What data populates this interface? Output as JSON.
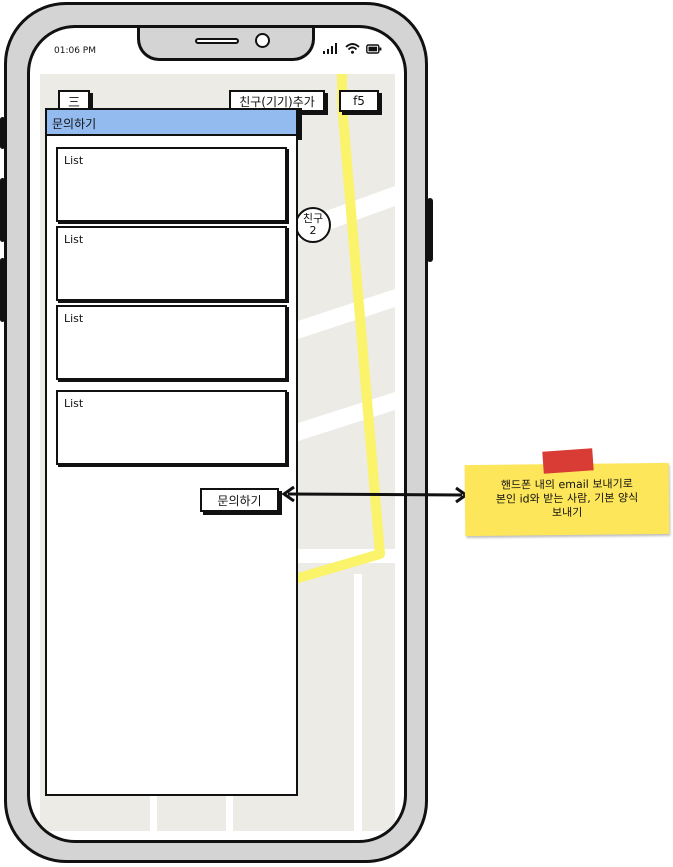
{
  "status_bar": {
    "time": "01:06 PM",
    "icons": [
      "signal-icon",
      "wifi-icon",
      "battery-icon"
    ]
  },
  "toolbar": {
    "menu_label": "三",
    "add_friend_label": "친구(기기)추가",
    "refresh_label": "f5"
  },
  "panel": {
    "title": "문의하기",
    "items": [
      {
        "label": "List"
      },
      {
        "label": "List"
      },
      {
        "label": "List"
      },
      {
        "label": "List"
      }
    ],
    "inquiry_button_label": "문의하기"
  },
  "map": {
    "friend_marker": {
      "line1": "친구",
      "line2": "2"
    },
    "route_color": "#fbf36a"
  },
  "annotation": {
    "line1": "핸드폰 내의 email 보내기로",
    "line2": "본인 id와 받는 사람, 기본 양식",
    "line3": "보내기"
  },
  "colors": {
    "panel_title_bg": "#93bbf0",
    "note_bg": "#fde65a",
    "tape": "#d93c34"
  }
}
